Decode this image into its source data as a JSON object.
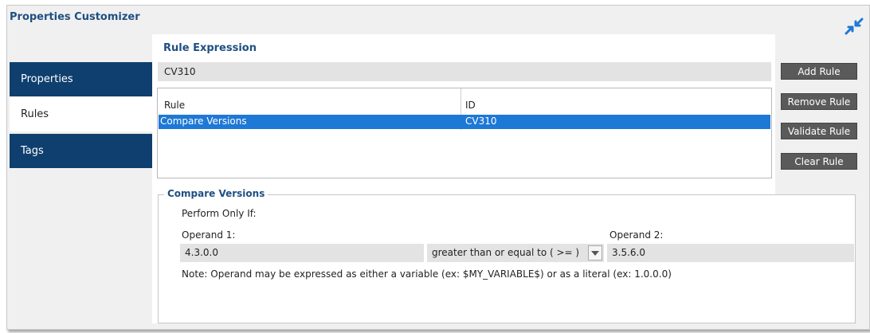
{
  "window": {
    "title": "Properties Customizer",
    "collapse_icon": "collapse-arrows-icon"
  },
  "tabs": [
    {
      "label": "Properties",
      "active": false
    },
    {
      "label": "Rules",
      "active": true
    },
    {
      "label": "Tags",
      "active": false
    }
  ],
  "rule_expression": {
    "title": "Rule Expression",
    "value": "CV310"
  },
  "rules_table": {
    "headers": [
      "Rule",
      "ID"
    ],
    "rows": [
      {
        "rule": "Compare Versions",
        "id": "CV310",
        "selected": true
      }
    ]
  },
  "buttons": {
    "add": "Add Rule",
    "remove": "Remove Rule",
    "validate": "Validate Rule",
    "clear": "Clear Rule"
  },
  "compare_versions": {
    "legend": "Compare Versions",
    "perform_only_if": "Perform Only If:",
    "operand1_label": "Operand 1:",
    "operand1_value": "4.3.0.0",
    "operator": "greater than or equal to ( >= )",
    "operand2_label": "Operand 2:",
    "operand2_value": "3.5.6.0",
    "note": "Note: Operand may be expressed as either a variable (ex: $MY_VARIABLE$) or as a literal (ex: 1.0.0.0)"
  },
  "colors": {
    "accent_blue": "#1f4f82",
    "tab_dark": "#0e3f6e",
    "selection": "#1e78d6",
    "button_gray": "#5a5a5a"
  }
}
